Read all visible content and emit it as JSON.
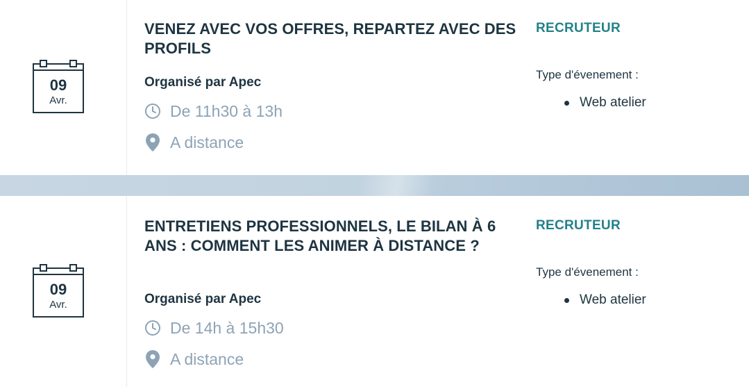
{
  "events": [
    {
      "date": {
        "day": "09",
        "month": "Avr."
      },
      "title": "VENEZ AVEC VOS OFFRES, REPARTEZ AVEC DES PROFILS",
      "organizer": "Organisé par Apec",
      "time": "De 11h30 à 13h",
      "location": "A distance",
      "tag": "RECRUTEUR",
      "type_label": "Type d'évenement :",
      "types": [
        "Web atelier"
      ]
    },
    {
      "date": {
        "day": "09",
        "month": "Avr."
      },
      "title": "ENTRETIENS PROFESSIONNELS, LE BILAN À 6 ANS : COMMENT LES ANIMER À DISTANCE ?",
      "organizer": "Organisé par Apec",
      "time": "De 14h à 15h30",
      "location": "A distance",
      "tag": "RECRUTEUR",
      "type_label": "Type d'évenement :",
      "types": [
        "Web atelier"
      ]
    }
  ],
  "icons": {
    "calendar": "calendar-icon",
    "clock": "clock-icon",
    "location": "map-pin-icon"
  },
  "colors": {
    "title": "#1e3441",
    "muted": "#8da3b5",
    "tag": "#22818a",
    "separator": "#b9cddd"
  }
}
